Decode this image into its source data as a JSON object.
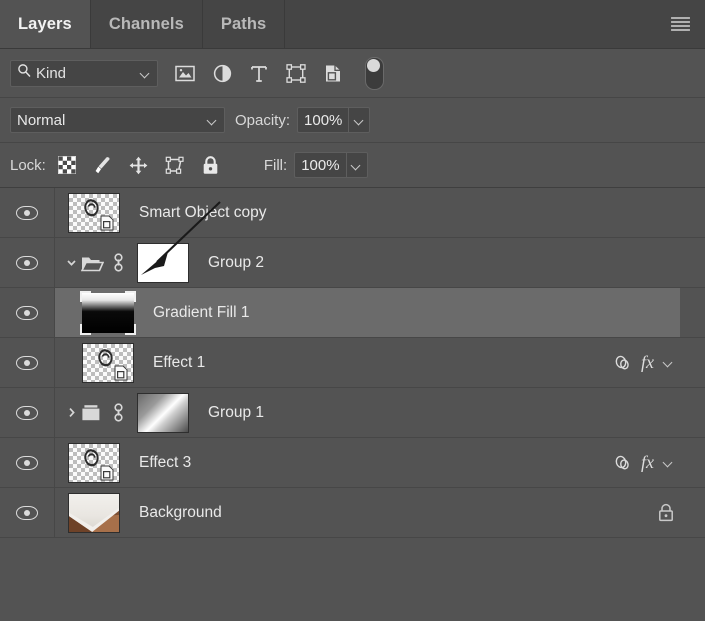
{
  "panel": {
    "title": "Layers",
    "menu_icon": "hamburger-menu-icon",
    "tabs": [
      {
        "label": "Layers",
        "active": true
      },
      {
        "label": "Channels",
        "active": false
      },
      {
        "label": "Paths",
        "active": false
      }
    ]
  },
  "filter_bar": {
    "search_icon": "magnifier-icon",
    "kind_label": "Kind",
    "dropdown_icon": "chevron-down-icon",
    "type_filters": [
      {
        "name": "pixel-layer-filter-icon",
        "title": "Filter for pixel layers"
      },
      {
        "name": "adjustment-layer-filter-icon",
        "title": "Filter for adjustment layers"
      },
      {
        "name": "type-layer-filter-icon",
        "title": "Filter for type layers"
      },
      {
        "name": "shape-layer-filter-icon",
        "title": "Filter for shape layers"
      },
      {
        "name": "smart-object-filter-icon",
        "title": "Filter for smart objects"
      }
    ],
    "toggle_name": "filter-enable-toggle"
  },
  "blend_bar": {
    "blend_mode": "Normal",
    "opacity_label": "Opacity:",
    "opacity_value": "100%"
  },
  "lock_bar": {
    "lock_label": "Lock:",
    "lock_icons": [
      {
        "name": "lock-transparent-pixels-icon"
      },
      {
        "name": "lock-image-pixels-icon"
      },
      {
        "name": "lock-position-icon"
      },
      {
        "name": "lock-artboard-nesting-icon"
      },
      {
        "name": "lock-all-icon"
      }
    ],
    "fill_label": "Fill:",
    "fill_value": "100%"
  },
  "layers": [
    {
      "name": "Smart Object copy",
      "visible": true,
      "selected": false,
      "kind": "smart-object",
      "indent": 0,
      "has_fx": false,
      "locked": false
    },
    {
      "name": "Group 2",
      "visible": true,
      "selected": false,
      "kind": "group",
      "expanded": true,
      "twirl": "chevron-down-icon",
      "linked": true,
      "indent": 0,
      "has_fx": false,
      "locked": false
    },
    {
      "name": "Gradient Fill 1",
      "visible": true,
      "selected": true,
      "kind": "gradient-fill",
      "indent": 1,
      "has_fx": false,
      "locked": false
    },
    {
      "name": "Effect 1",
      "visible": true,
      "selected": false,
      "kind": "smart-object",
      "indent": 1,
      "has_fx": true,
      "locked": false
    },
    {
      "name": "Group 1",
      "visible": true,
      "selected": false,
      "kind": "group",
      "expanded": false,
      "twirl": "chevron-right-icon",
      "linked": true,
      "indent": 0,
      "has_fx": false,
      "locked": false
    },
    {
      "name": "Effect 3",
      "visible": true,
      "selected": false,
      "kind": "smart-object",
      "indent": 0,
      "has_fx": true,
      "locked": false
    },
    {
      "name": "Background",
      "visible": true,
      "selected": false,
      "kind": "image",
      "indent": 0,
      "has_fx": false,
      "locked": true
    }
  ],
  "fx_badge": {
    "effects_icon": "layer-effects-icon",
    "label": "fx",
    "expand_icon": "chevron-down-icon"
  },
  "annotation": {
    "arrow_name": "annotation-arrow",
    "points_to": "Group 2 layer mask thumbnail",
    "color": "#1a1a1a"
  },
  "colors": {
    "panel_bg": "#535353",
    "tab_bg": "#454545",
    "row_selected": "#6b6b6b",
    "text": "#e9e9e9",
    "field_bg": "#454545"
  }
}
